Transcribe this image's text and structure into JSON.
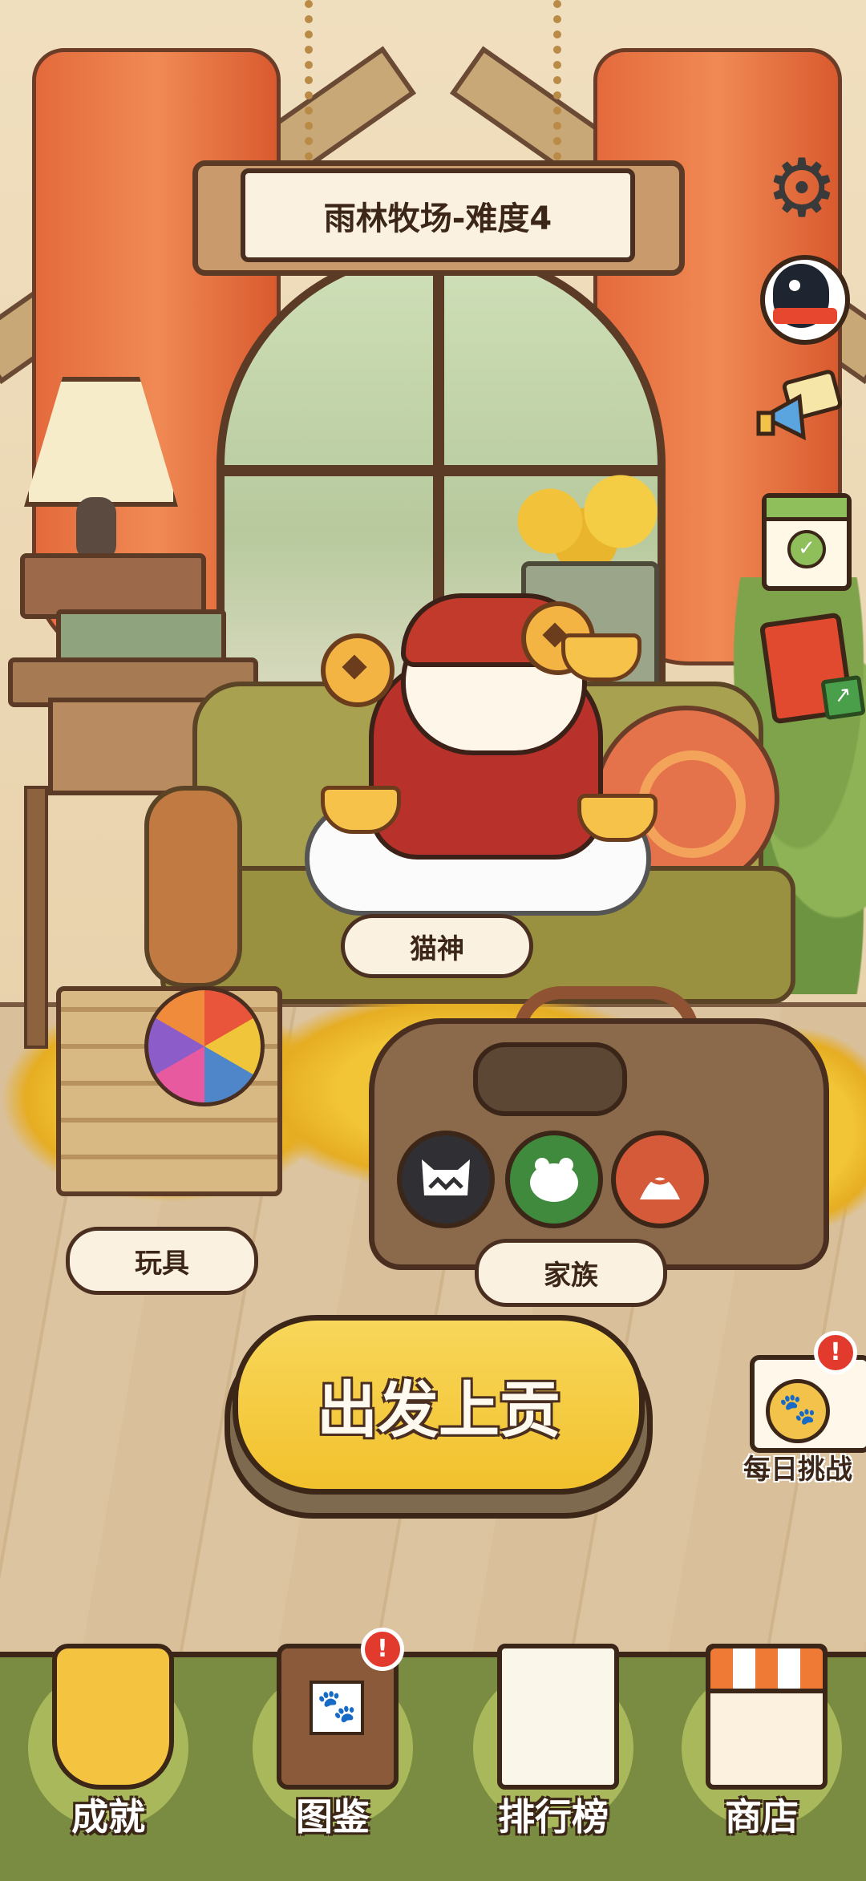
{
  "header": {
    "title": "雨林牧场-难度4"
  },
  "scene": {
    "cat_label": "猫神",
    "toy_label": "玩具",
    "family_label": "家族"
  },
  "side_buttons": [
    "gear-icon",
    "qq-penguin-icon",
    "megaphone-mail-icon",
    "calendar-check-icon",
    "red-packet-share-icon"
  ],
  "bag_buttons": [
    "cat-face-icon",
    "green-frog-icon",
    "orange-bag-icon"
  ],
  "main_action": {
    "label": "出发上贡"
  },
  "daily_challenge": {
    "label": "每日挑战",
    "badge": "!"
  },
  "bottom_nav": {
    "items": [
      {
        "label": "成就",
        "icon": "trophy-icon"
      },
      {
        "label": "图鉴",
        "icon": "album-icon",
        "badge": "!"
      },
      {
        "label": "排行榜",
        "icon": "scroll-icon"
      },
      {
        "label": "商店",
        "icon": "shop-icon"
      }
    ]
  },
  "colors": {
    "accent": "#f2c12d",
    "badge": "#e23a2c",
    "nav_bg": "#7a8c41",
    "text": "#3b2618"
  }
}
